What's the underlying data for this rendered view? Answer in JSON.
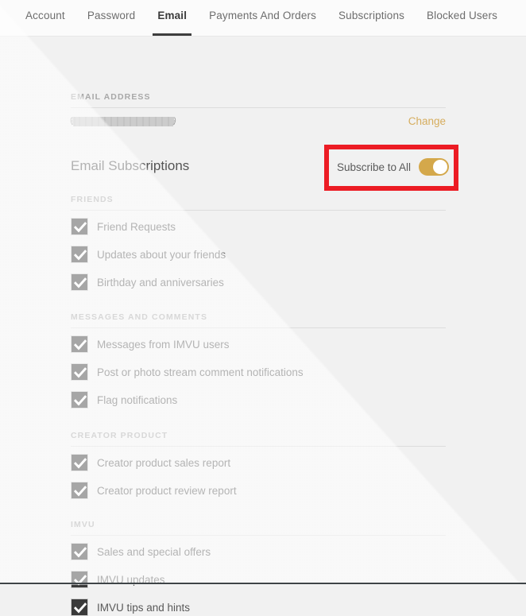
{
  "tabs": [
    {
      "label": "Account",
      "active": false
    },
    {
      "label": "Password",
      "active": false
    },
    {
      "label": "Email",
      "active": true
    },
    {
      "label": "Payments And Orders",
      "active": false
    },
    {
      "label": "Subscriptions",
      "active": false
    },
    {
      "label": "Blocked Users",
      "active": false
    }
  ],
  "email_address": {
    "section_label": "EMAIL ADDRESS",
    "value": "",
    "redacted": true,
    "change_link": "Change"
  },
  "subscriptions": {
    "heading": "Email Subscriptions",
    "subscribe_all_label": "Subscribe to All",
    "subscribe_all_state": "on",
    "toggle_color": "#d4a84b",
    "annotation_box_color": "#ec1c24"
  },
  "groups": [
    {
      "label": "FRIENDS",
      "items": [
        {
          "label": "Friend Requests",
          "checked": true
        },
        {
          "label": "Updates about your friends",
          "checked": true
        },
        {
          "label": "Birthday and anniversaries",
          "checked": true
        }
      ]
    },
    {
      "label": "MESSAGES AND COMMENTS",
      "items": [
        {
          "label": "Messages from IMVU users",
          "checked": true
        },
        {
          "label": "Post or photo stream comment notifications",
          "checked": true
        },
        {
          "label": "Flag notifications",
          "checked": true
        }
      ]
    },
    {
      "label": "CREATOR PRODUCT",
      "items": [
        {
          "label": "Creator product sales report",
          "checked": true
        },
        {
          "label": "Creator product review report",
          "checked": true
        }
      ]
    },
    {
      "label": "IMVU",
      "items": [
        {
          "label": "Sales and special offers",
          "checked": true
        },
        {
          "label": "IMVU updates",
          "checked": true
        },
        {
          "label": "IMVU tips and hints",
          "checked": true
        }
      ]
    }
  ],
  "colors": {
    "accent_gold": "#d4a84b",
    "link_gold": "#d6ad5e",
    "checkbox_fill": "#3a3a3a",
    "page_background": "#f1f1f1",
    "annotation_red": "#ec1c24"
  }
}
